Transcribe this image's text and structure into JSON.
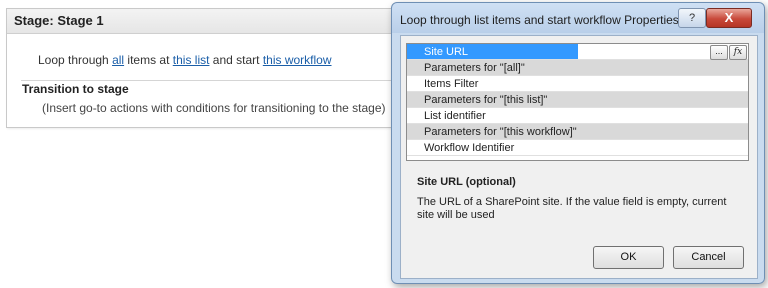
{
  "stage": {
    "title": "Stage: Stage 1",
    "line": {
      "prefix": "Loop through ",
      "link_all": "all",
      "middle1": " items at ",
      "link_list": "this list",
      "middle2": " and start ",
      "link_workflow": "this workflow"
    },
    "transition_title": "Transition to stage",
    "transition_note": "(Insert go-to actions with conditions for transitioning to the stage)"
  },
  "dialog": {
    "title": "Loop through list items and start workflow Properties",
    "help_label": "?",
    "close_label": "X",
    "rows": [
      {
        "label": "Site URL",
        "kind": "selected"
      },
      {
        "label": "Parameters for \"[all]\"",
        "kind": "group"
      },
      {
        "label": "Items Filter",
        "kind": "item"
      },
      {
        "label": "Parameters for \"[this list]\"",
        "kind": "group"
      },
      {
        "label": "List identifier",
        "kind": "item"
      },
      {
        "label": "Parameters for \"[this workflow]\"",
        "kind": "group"
      },
      {
        "label": "Workflow Identifier",
        "kind": "item"
      }
    ],
    "ellipsis_label": "...",
    "fx_label": "fx",
    "description_title": "Site URL (optional)",
    "description_text": "The URL of a SharePoint site. If the value field is empty, current site will be used",
    "ok_label": "OK",
    "cancel_label": "Cancel"
  }
}
